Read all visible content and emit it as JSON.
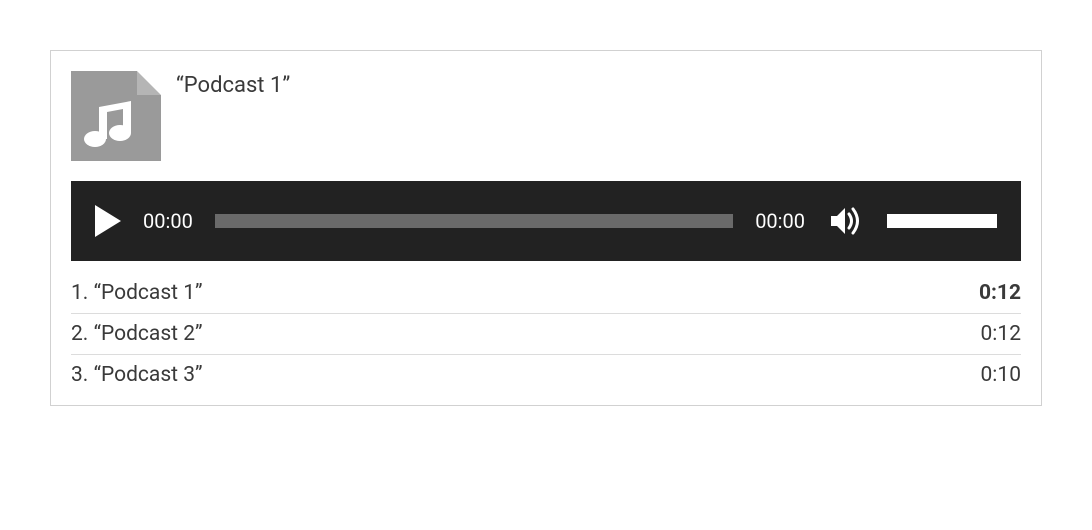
{
  "current": {
    "title": "“Podcast 1”"
  },
  "player": {
    "elapsed": "00:00",
    "total": "00:00"
  },
  "playlist": [
    {
      "num": "1.",
      "title": "“Podcast 1”",
      "duration": "0:12",
      "active": true
    },
    {
      "num": "2.",
      "title": "“Podcast 2”",
      "duration": "0:12",
      "active": false
    },
    {
      "num": "3.",
      "title": "“Podcast 3”",
      "duration": "0:10",
      "active": false
    }
  ]
}
